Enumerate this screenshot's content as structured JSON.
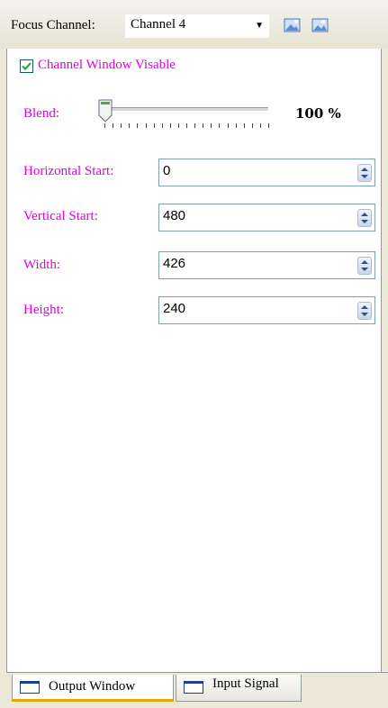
{
  "toolbar": {
    "focus_label": "Focus Channel:",
    "channel_value": "Channel 4",
    "btn1_icon": "picture-icon",
    "btn2_icon": "picture-icon"
  },
  "channel_window": {
    "visible_label": "Channel Window Visable",
    "visible_checked": true
  },
  "blend": {
    "label": "Blend:",
    "value_text": "100 %",
    "level_percent": 100
  },
  "fields": {
    "horizontal_start": {
      "label": "Horizontal Start:",
      "value": "0"
    },
    "vertical_start": {
      "label": "Vertical Start:",
      "value": "480"
    },
    "width": {
      "label": "Width:",
      "value": "426"
    },
    "height": {
      "label": "Height:",
      "value": "240"
    }
  },
  "tabs": [
    {
      "label": "Output Window",
      "active": true
    },
    {
      "label": "Input Signal",
      "active": false
    }
  ],
  "colors": {
    "label_accent": "#e000e0",
    "tab_active_underline": "#e6a800"
  }
}
